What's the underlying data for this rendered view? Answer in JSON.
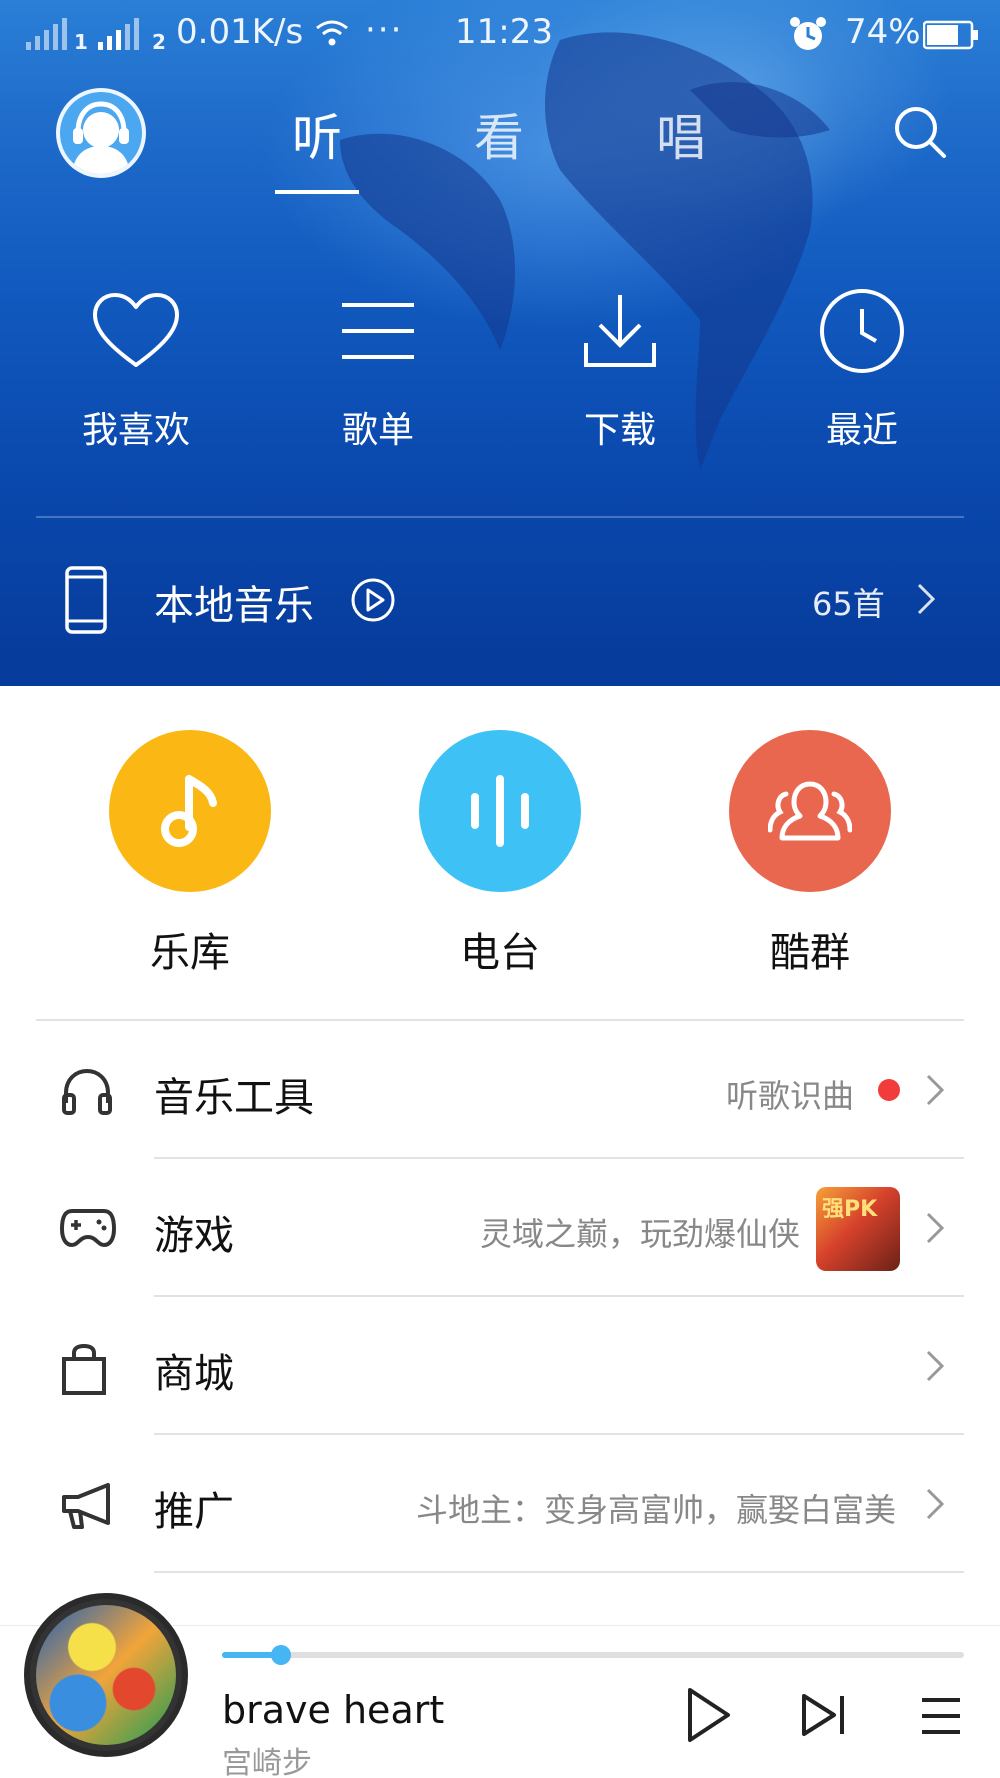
{
  "status_bar": {
    "sim1_label": "1",
    "sim2_label": "2",
    "network_speed": "0.01K/s",
    "more": "···",
    "time": "11:23",
    "battery_percent": "74%",
    "battery_level": 0.74
  },
  "top_nav": {
    "tabs": [
      {
        "label": "听",
        "active": true
      },
      {
        "label": "看",
        "active": false
      },
      {
        "label": "唱",
        "active": false
      }
    ]
  },
  "shortcuts": [
    {
      "label": "我喜欢",
      "icon": "heart-icon"
    },
    {
      "label": "歌单",
      "icon": "list-icon"
    },
    {
      "label": "下载",
      "icon": "download-icon"
    },
    {
      "label": "最近",
      "icon": "clock-icon"
    }
  ],
  "local_music": {
    "title": "本地音乐",
    "count": "65首"
  },
  "categories": [
    {
      "label": "乐库",
      "color": "#fbb713",
      "icon": "music-note-icon"
    },
    {
      "label": "电台",
      "color": "#3ec1f5",
      "icon": "radio-bars-icon"
    },
    {
      "label": "酷群",
      "color": "#e9674f",
      "icon": "group-icon"
    }
  ],
  "list": [
    {
      "title": "音乐工具",
      "subtitle": "听歌识曲",
      "icon": "headphones-icon",
      "has_dot": true
    },
    {
      "title": "游戏",
      "subtitle": "灵域之巅，玩劲爆仙侠",
      "icon": "gamepad-icon",
      "thumb_text": "强PK"
    },
    {
      "title": "商城",
      "subtitle": "",
      "icon": "shopping-bag-icon"
    },
    {
      "title": "推广",
      "subtitle": "斗地主：变身高富帅，赢娶白富美",
      "icon": "megaphone-icon"
    }
  ],
  "player": {
    "song": "brave heart",
    "artist": "宫崎步",
    "progress": 0.08
  },
  "colors": {
    "accent": "#45b6f2",
    "hero_blue": "#125bc0",
    "red_dot": "#f23b3b"
  }
}
